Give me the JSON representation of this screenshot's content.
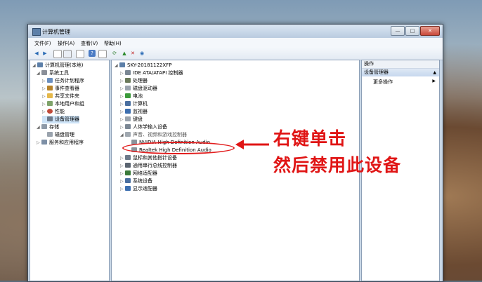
{
  "window": {
    "title": "计算机管理",
    "buttons": [
      "—",
      "□",
      "✕"
    ]
  },
  "menu": [
    "文件(F)",
    "操作(A)",
    "查看(V)",
    "帮助(H)"
  ],
  "left_tree": [
    {
      "label": "计算机管理(本地)",
      "level": 0,
      "icon": "computer-icon"
    },
    {
      "label": "系统工具",
      "level": 1,
      "icon": "tools-icon"
    },
    {
      "label": "任务计划程序",
      "level": 2,
      "icon": "clock-icon"
    },
    {
      "label": "事件查看器",
      "level": 2,
      "icon": "event-icon"
    },
    {
      "label": "共享文件夹",
      "level": 2,
      "icon": "folder-icon"
    },
    {
      "label": "本地用户和组",
      "level": 2,
      "icon": "users-icon"
    },
    {
      "label": "性能",
      "level": 2,
      "icon": "performance-icon"
    },
    {
      "label": "设备管理器",
      "level": 2,
      "icon": "device-manager-icon"
    },
    {
      "label": "存储",
      "level": 1,
      "icon": "storage-icon"
    },
    {
      "label": "磁盘管理",
      "level": 2,
      "icon": "disk-icon"
    },
    {
      "label": "服务和应用程序",
      "level": 1,
      "icon": "services-icon"
    }
  ],
  "device_tree": {
    "root": "SKY-20181122XFP",
    "items": [
      {
        "label": "IDE ATA/ATAPI 控制器",
        "icon": "ide-icon"
      },
      {
        "label": "处理器",
        "icon": "cpu-icon"
      },
      {
        "label": "磁盘驱动器",
        "icon": "disk-drive-icon"
      },
      {
        "label": "电池",
        "icon": "battery-icon"
      },
      {
        "label": "计算机",
        "icon": "computer-icon"
      },
      {
        "label": "监视器",
        "icon": "monitor-icon"
      },
      {
        "label": "键盘",
        "icon": "keyboard-icon"
      },
      {
        "label": "人体学输入设备",
        "icon": "hid-icon"
      },
      {
        "label": "声音、视频和游戏控制器",
        "icon": "sound-icon",
        "expanded": true
      },
      {
        "label": "NVIDIA High Definition Audio",
        "icon": "speaker-icon",
        "child": true
      },
      {
        "label": "Realtek High Definition Audio",
        "icon": "speaker-icon",
        "child": true
      },
      {
        "label": "鼠标和其他指针设备",
        "icon": "mouse-icon"
      },
      {
        "label": "通用串行总线控制器",
        "icon": "usb-icon"
      },
      {
        "label": "网络适配器",
        "icon": "network-icon"
      },
      {
        "label": "系统设备",
        "icon": "system-icon"
      },
      {
        "label": "显示适配器",
        "icon": "display-icon"
      }
    ]
  },
  "actions": {
    "header": "操作",
    "section": "设备管理器",
    "more": "更多操作"
  },
  "annotation": {
    "line1": "右键单击",
    "line2": "然后禁用此设备",
    "color": "#e01515"
  }
}
